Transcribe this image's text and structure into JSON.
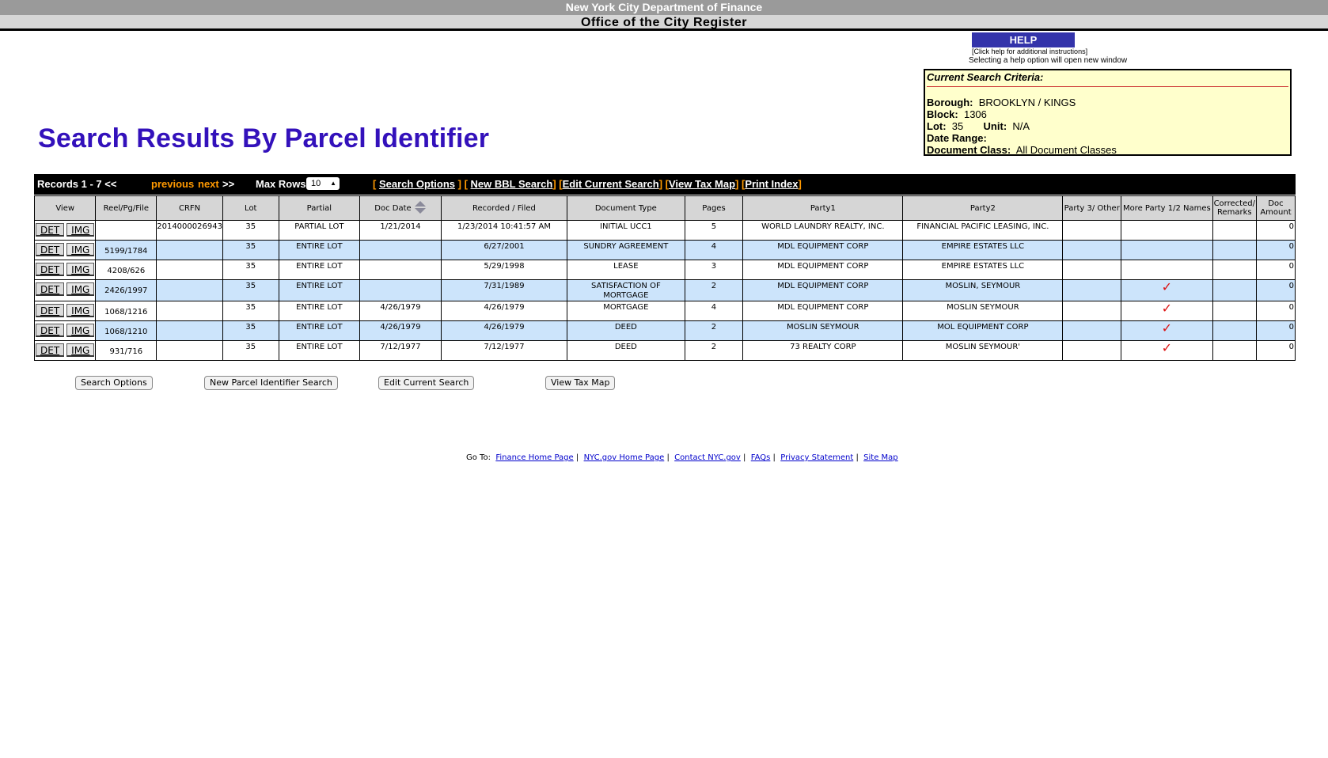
{
  "header": {
    "title": "New York City Department of Finance",
    "subtitle": "Office of the City Register"
  },
  "help": {
    "label": "HELP",
    "note1": "[Click help for additional instructions]",
    "note2": "Selecting a help option will open new window"
  },
  "criteria": {
    "title": "Current Search Criteria:",
    "borough_label": "Borough:",
    "borough_value": "BROOKLYN / KINGS",
    "block_label": "Block:",
    "block_value": "1306",
    "lot_label": "Lot:",
    "lot_value": "35",
    "unit_label": "Unit:",
    "unit_value": "N/A",
    "date_range_label": "Date Range:",
    "doc_class_label": "Document Class:",
    "doc_class_value": "All Document Classes"
  },
  "page_title": "Search Results By Parcel Identifier",
  "nav": {
    "records": "Records 1 - 7 <<",
    "previous": "previous",
    "next": "next",
    "gtgt": ">>",
    "max_rows_label": "Max Rows",
    "max_rows_value": "10",
    "link_search_options": "Search Options",
    "link_new_bbl": "New BBL Search",
    "link_edit_current": "Edit Current Search",
    "link_view_tax_map": "View Tax Map",
    "link_print_index": "Print Index"
  },
  "table": {
    "headers": [
      "View",
      "Reel/Pg/File",
      "CRFN",
      "Lot",
      "Partial",
      "Doc Date",
      "Recorded / Filed",
      "Document Type",
      "Pages",
      "Party1",
      "Party2",
      "Party 3/ Other",
      "More Party 1/2 Names",
      "Corrected/ Remarks",
      "Doc Amount"
    ],
    "det_label": "DET",
    "img_label": "IMG",
    "rows": [
      {
        "reel": "",
        "crfn": "2014000026943",
        "lot": "35",
        "partial": "PARTIAL LOT",
        "doc_date": "1/21/2014",
        "recorded": "1/23/2014 10:41:57 AM",
        "doc_type": "INITIAL UCC1",
        "pages": "5",
        "party1": "WORLD LAUNDRY REALTY, INC.",
        "party2": "FINANCIAL PACIFIC LEASING, INC.",
        "party3": "",
        "more": "",
        "corrected": "",
        "amount": "0"
      },
      {
        "reel": "5199/1784",
        "crfn": "",
        "lot": "35",
        "partial": "ENTIRE LOT",
        "doc_date": "",
        "recorded": "6/27/2001",
        "doc_type": "SUNDRY AGREEMENT",
        "pages": "4",
        "party1": "MDL EQUIPMENT CORP",
        "party2": "EMPIRE ESTATES LLC",
        "party3": "",
        "more": "",
        "corrected": "",
        "amount": "0"
      },
      {
        "reel": "4208/626",
        "crfn": "",
        "lot": "35",
        "partial": "ENTIRE LOT",
        "doc_date": "",
        "recorded": "5/29/1998",
        "doc_type": "LEASE",
        "pages": "3",
        "party1": "MDL EQUIPMENT CORP",
        "party2": "EMPIRE ESTATES LLC",
        "party3": "",
        "more": "",
        "corrected": "",
        "amount": "0"
      },
      {
        "reel": "2426/1997",
        "crfn": "",
        "lot": "35",
        "partial": "ENTIRE LOT",
        "doc_date": "",
        "recorded": "7/31/1989",
        "doc_type": "SATISFACTION OF MORTGAGE",
        "pages": "2",
        "party1": "MDL EQUIPMENT CORP",
        "party2": "MOSLIN, SEYMOUR",
        "party3": "",
        "more": "✓",
        "corrected": "",
        "amount": "0"
      },
      {
        "reel": "1068/1216",
        "crfn": "",
        "lot": "35",
        "partial": "ENTIRE LOT",
        "doc_date": "4/26/1979",
        "recorded": "4/26/1979",
        "doc_type": "MORTGAGE",
        "pages": "4",
        "party1": "MDL EQUIPMENT CORP",
        "party2": "MOSLIN SEYMOUR",
        "party3": "",
        "more": "✓",
        "corrected": "",
        "amount": "0"
      },
      {
        "reel": "1068/1210",
        "crfn": "",
        "lot": "35",
        "partial": "ENTIRE LOT",
        "doc_date": "4/26/1979",
        "recorded": "4/26/1979",
        "doc_type": "DEED",
        "pages": "2",
        "party1": "MOSLIN SEYMOUR",
        "party2": "MOL EQUIPMENT CORP",
        "party3": "",
        "more": "✓",
        "corrected": "",
        "amount": "0"
      },
      {
        "reel": "931/716",
        "crfn": "",
        "lot": "35",
        "partial": "ENTIRE LOT",
        "doc_date": "7/12/1977",
        "recorded": "7/12/1977",
        "doc_type": "DEED",
        "pages": "2",
        "party1": "73 REALTY CORP",
        "party2": "MOSLIN SEYMOUR'",
        "party3": "",
        "more": "✓",
        "corrected": "",
        "amount": "0"
      }
    ]
  },
  "buttons": {
    "search_options": "Search Options",
    "new_parcel": "New Parcel Identifier Search",
    "edit_current": "Edit Current Search",
    "view_tax_map": "View Tax Map"
  },
  "footer": {
    "goto": "Go To:",
    "links": [
      "Finance Home Page",
      "NYC.gov Home Page",
      "Contact NYC.gov",
      "FAQs",
      "Privacy Statement",
      "Site Map"
    ]
  },
  "colors": {
    "title_blue": "#3311bb",
    "row_alt": "#cce4fb",
    "criteria_bg": "#ffffcc",
    "nav_orange": "#ff9900",
    "check_red": "#dd1111"
  }
}
